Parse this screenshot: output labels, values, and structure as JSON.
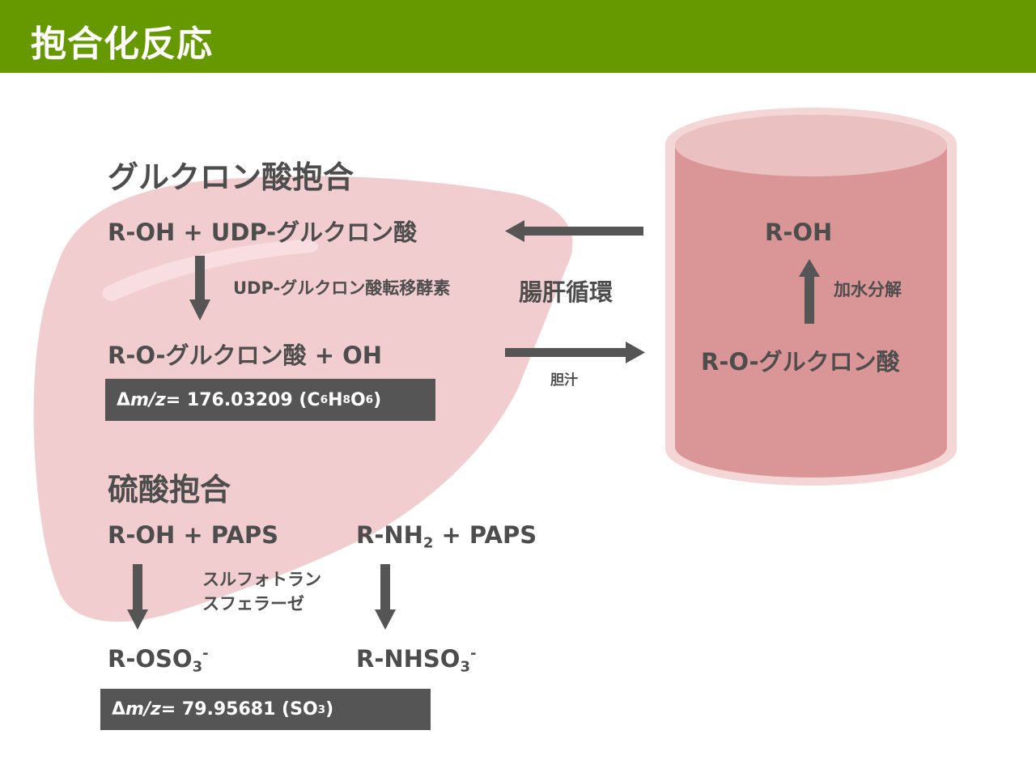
{
  "header": {
    "title": "抱合化反応"
  },
  "glucuronide": {
    "heading": "グルクロン酸抱合",
    "reactant": "R-OH + UDP-グルクロン酸",
    "enzyme": "UDP-グルクロン酸転移酵素",
    "product": "R-O-グルクロン酸 + OH",
    "mass_prefix": "Δ",
    "mass_var": "m/z",
    "mass_value": " = 176.03209 (C",
    "mass_s1": "6",
    "mass_h": "H",
    "mass_s2": "8",
    "mass_o": "O",
    "mass_s3": "6",
    "mass_close": ")"
  },
  "cycle": {
    "enterohepatic_label": "腸肝循環",
    "bile_label": "胆汁",
    "intestine_top": "R-OH",
    "hydrolysis_label": "加水分解",
    "intestine_bottom": "R-O-グルクロン酸"
  },
  "sulfate": {
    "heading": "硫酸抱合",
    "reactant1": "R-OH + PAPS",
    "reactant2_pre": "R-NH",
    "reactant2_sub": "2",
    "reactant2_post": " + PAPS",
    "enzyme_line1": "スルフォトラン",
    "enzyme_line2": "スフェラーゼ",
    "product1_pre": "R-OSO",
    "product1_sub": "3",
    "product1_sup": "-",
    "product2_pre": "R-NHSO",
    "product2_sub": "3",
    "product2_sup": "-",
    "mass_prefix": "Δ",
    "mass_var": "m/z",
    "mass_value": " = 79.95681 (SO",
    "mass_s1": "3",
    "mass_close": ")"
  },
  "colors": {
    "header_bg": "#669900",
    "liver": "#f0c4c8",
    "intestine_body": "#da9696",
    "intestine_top": "#eac0c0",
    "arrow": "#555555"
  }
}
